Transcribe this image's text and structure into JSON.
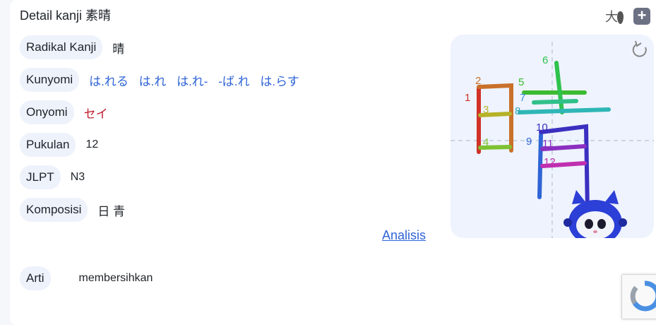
{
  "header": {
    "title": "Detail kanji 素晴"
  },
  "toolbar": {
    "font_icon_glyph": "大",
    "add_label": "+"
  },
  "details": {
    "radikal": {
      "label": "Radikal Kanji",
      "value": "晴"
    },
    "kunyomi": {
      "label": "Kunyomi",
      "readings": [
        "は.れる",
        "は.れ",
        "は.れ-",
        "-ば.れ",
        "は.らす"
      ]
    },
    "onyomi": {
      "label": "Onyomi",
      "value": "セイ"
    },
    "pukulan": {
      "label": "Pukulan",
      "value": "12"
    },
    "jlpt": {
      "label": "JLPT",
      "value": "N3"
    },
    "komposisi": {
      "label": "Komposisi",
      "value": "日 青"
    },
    "analisis_link": "Analisis",
    "arti": {
      "label": "Arti",
      "value": "membersihkan"
    }
  },
  "stroke_panel": {
    "kanji": "晴",
    "stroke_numbers": [
      "1",
      "2",
      "3",
      "4",
      "5",
      "6",
      "7",
      "8",
      "9",
      "10",
      "11",
      "12"
    ]
  },
  "colors": {
    "accent_blue": "#2f64d6",
    "onyomi_red": "#c01f2f",
    "pill_bg": "#eef2fb"
  }
}
